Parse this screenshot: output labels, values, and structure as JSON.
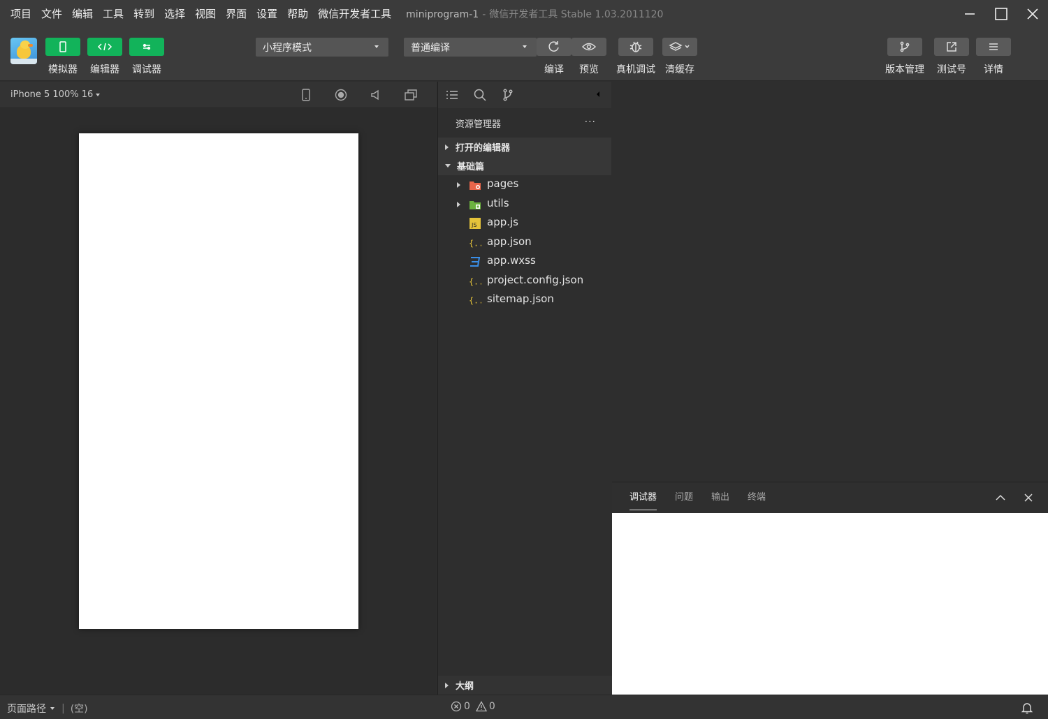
{
  "menu": [
    "项目",
    "文件",
    "编辑",
    "工具",
    "转到",
    "选择",
    "视图",
    "界面",
    "设置",
    "帮助",
    "微信开发者工具"
  ],
  "title": {
    "project": "miniprogram-1",
    "separator": "-",
    "app": "微信开发者工具 Stable 1.03.2011120"
  },
  "toolbar": {
    "simulator": "模拟器",
    "editor": "编辑器",
    "debugger": "调试器",
    "mode_select": "小程序模式",
    "compile_select": "普通编译",
    "compile": "编译",
    "preview": "预览",
    "remote_debug": "真机调试",
    "clear_cache": "清缓存",
    "version": "版本管理",
    "test_account": "测试号",
    "details": "详情"
  },
  "simulator": {
    "device": "iPhone 5 100% 16"
  },
  "explorer": {
    "title": "资源管理器",
    "more": "···",
    "open_editors": "打开的编辑器",
    "project_section": "基础篇",
    "items": [
      {
        "name": "pages",
        "type": "folder-pages"
      },
      {
        "name": "utils",
        "type": "folder-utils"
      },
      {
        "name": "app.js",
        "type": "js"
      },
      {
        "name": "app.json",
        "type": "json"
      },
      {
        "name": "app.wxss",
        "type": "wxss"
      },
      {
        "name": "project.config.json",
        "type": "json"
      },
      {
        "name": "sitemap.json",
        "type": "json"
      }
    ],
    "outline": "大纲"
  },
  "debugger_panel": {
    "tabs": [
      "调试器",
      "问题",
      "输出",
      "终端"
    ]
  },
  "statusbar": {
    "page_path": "页面路径",
    "page_value": "(空)",
    "errors": "0",
    "warnings": "0"
  },
  "colors": {
    "accent_green": "#12b35a",
    "folder_pages": "#e8654a",
    "folder_utils": "#6cb33f",
    "js": "#e5c33a",
    "json": "#e5c33a",
    "wxss": "#3a8fe8"
  }
}
